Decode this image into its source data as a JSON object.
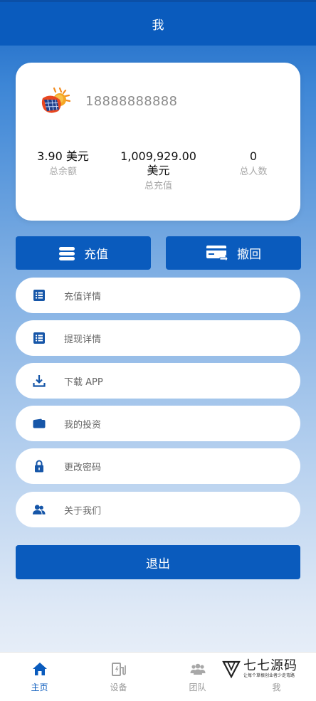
{
  "header": {
    "title": "我"
  },
  "profile": {
    "phone": "18888888888",
    "stats": [
      {
        "value": "3.90 美元",
        "label": "总余额"
      },
      {
        "value": "1,009,929.00 美元",
        "label": "总充值"
      },
      {
        "value": "0",
        "label": "总人数"
      }
    ]
  },
  "actions": {
    "recharge_label": "充值",
    "withdraw_label": "撤回"
  },
  "menu": [
    {
      "label": "充值详情",
      "icon": "list-icon"
    },
    {
      "label": "提现详情",
      "icon": "list-icon"
    },
    {
      "label": "下载 APP",
      "icon": "download-icon"
    },
    {
      "label": "我的投资",
      "icon": "wallet-icon"
    },
    {
      "label": "更改密码",
      "icon": "lock-icon"
    },
    {
      "label": "关于我们",
      "icon": "users-icon"
    }
  ],
  "logout_label": "退出",
  "tabbar": [
    {
      "label": "主页",
      "icon": "home-icon",
      "active": true
    },
    {
      "label": "设备",
      "icon": "charger-icon",
      "active": false
    },
    {
      "label": "团队",
      "icon": "team-icon",
      "active": false
    },
    {
      "label": "我",
      "icon": "user-icon",
      "active": false
    }
  ],
  "watermark": {
    "title": "七七源码",
    "subtitle": "让每个草根创业者少走弯路"
  },
  "colors": {
    "primary": "#0a5bbd",
    "active_tab": "#0a5bbd",
    "inactive_tab": "#9a9a9a"
  }
}
